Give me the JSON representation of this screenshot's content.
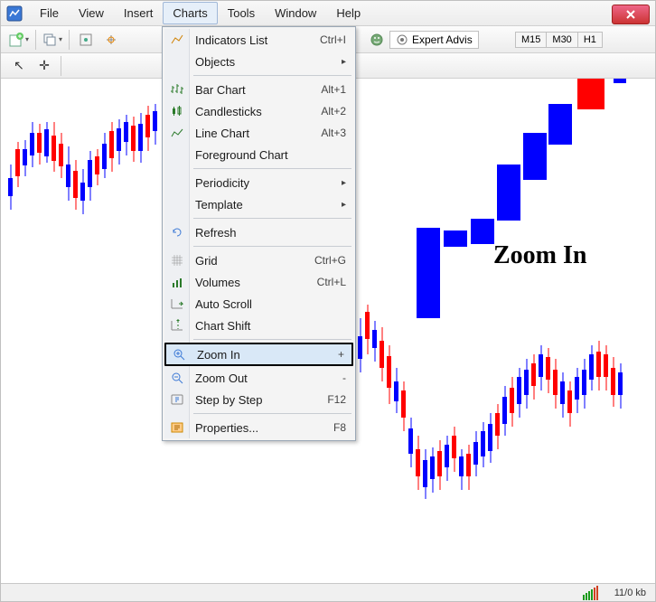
{
  "menubar": {
    "file": "File",
    "view": "View",
    "insert": "Insert",
    "charts": "Charts",
    "tools": "Tools",
    "window": "Window",
    "help": "Help"
  },
  "toolbar": {
    "expert_advisors": "Expert Advis",
    "timeframes": {
      "m15": "M15",
      "m30": "M30",
      "h1": "H1"
    }
  },
  "dropdown": {
    "indicators_list": {
      "label": "Indicators List",
      "shortcut": "Ctrl+I"
    },
    "objects": {
      "label": "Objects"
    },
    "bar_chart": {
      "label": "Bar Chart",
      "shortcut": "Alt+1"
    },
    "candlesticks": {
      "label": "Candlesticks",
      "shortcut": "Alt+2"
    },
    "line_chart": {
      "label": "Line Chart",
      "shortcut": "Alt+3"
    },
    "foreground_chart": {
      "label": "Foreground Chart"
    },
    "periodicity": {
      "label": "Periodicity"
    },
    "template": {
      "label": "Template"
    },
    "refresh": {
      "label": "Refresh"
    },
    "grid": {
      "label": "Grid",
      "shortcut": "Ctrl+G"
    },
    "volumes": {
      "label": "Volumes",
      "shortcut": "Ctrl+L"
    },
    "auto_scroll": {
      "label": "Auto Scroll"
    },
    "chart_shift": {
      "label": "Chart Shift"
    },
    "zoom_in": {
      "label": "Zoom In",
      "shortcut": "+"
    },
    "zoom_out": {
      "label": "Zoom Out",
      "shortcut": "-"
    },
    "step_by_step": {
      "label": "Step by Step",
      "shortcut": "F12"
    },
    "properties": {
      "label": "Properties...",
      "shortcut": "F8"
    }
  },
  "annotation": "Zoom In",
  "statusbar": {
    "kb": "11/0 kb"
  }
}
